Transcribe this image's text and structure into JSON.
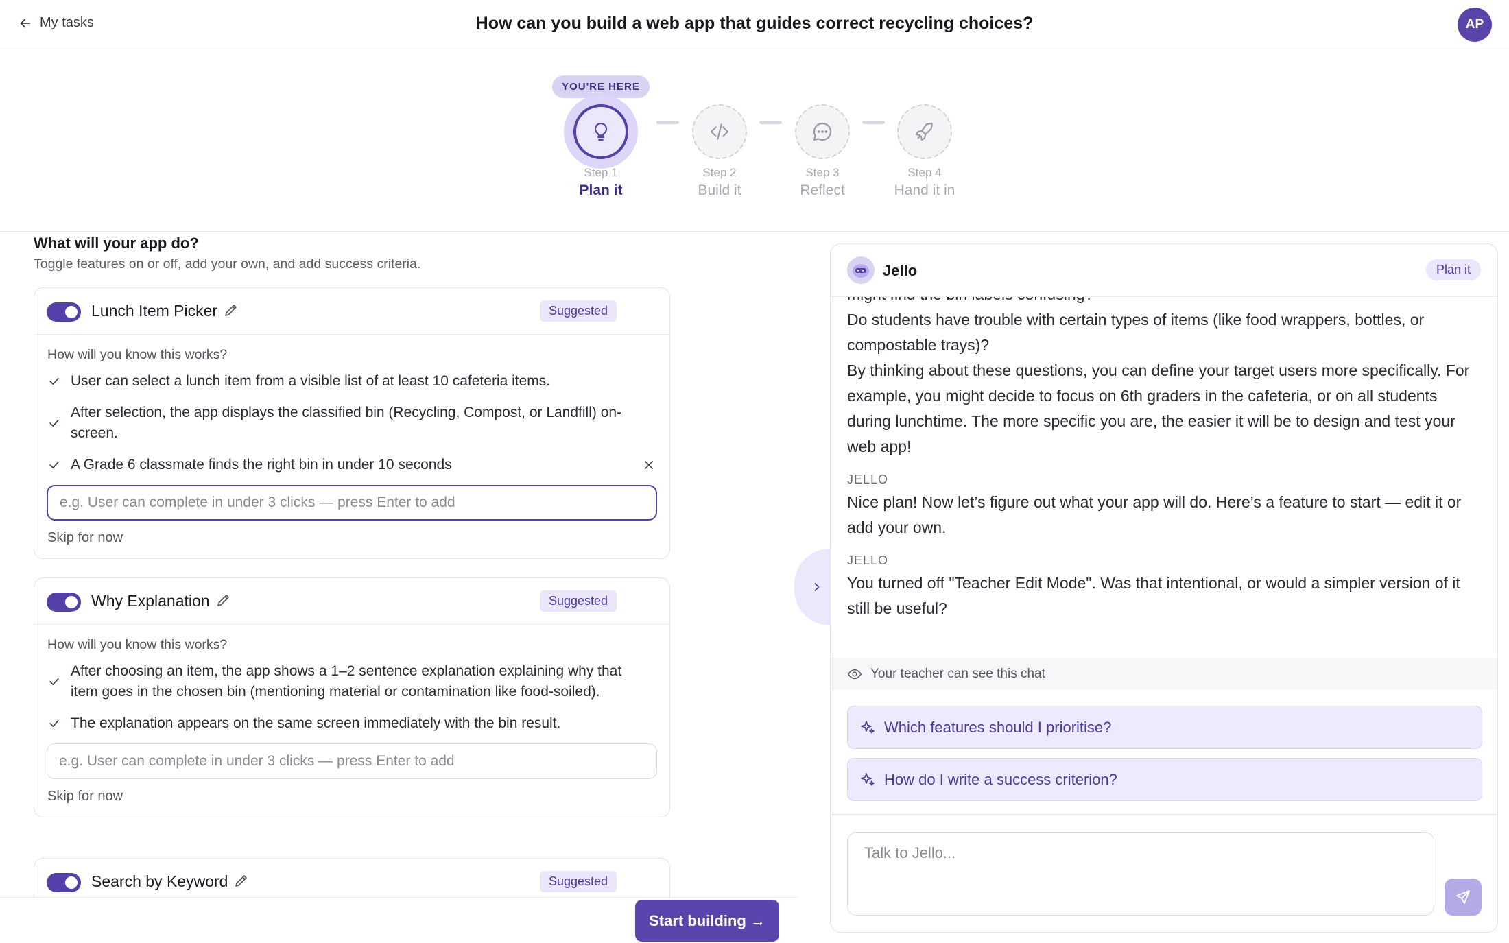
{
  "header": {
    "back_label": "My tasks",
    "title": "How can you build a web app that guides correct recycling choices?",
    "avatar_initials": "AP"
  },
  "stepper": {
    "here_badge": "YOU'RE HERE",
    "steps": [
      {
        "num": "Step 1",
        "label": "Plan it",
        "icon": "lightbulb-icon"
      },
      {
        "num": "Step 2",
        "label": "Build it",
        "icon": "code-icon"
      },
      {
        "num": "Step 3",
        "label": "Reflect",
        "icon": "chat-bubble-icon"
      },
      {
        "num": "Step 4",
        "label": "Hand it in",
        "icon": "rocket-icon"
      }
    ]
  },
  "features": {
    "title": "What will your app do?",
    "subtitle": "Toggle features on or off, add your own, and add success criteria.",
    "how_label": "How will you know this works?",
    "skip_label": "Skip for now",
    "input_placeholder": "e.g. User can complete in under 3 clicks — press Enter to add",
    "items": [
      {
        "name": "Lunch Item Picker",
        "badge": "Suggested",
        "enabled": true,
        "criteria": [
          "User can select a lunch item from a visible list of at least 10 cafeteria items.",
          "After selection, the app displays the classified bin (Recycling, Compost, or Landfill) on-screen.",
          "A Grade 6 classmate finds the right bin in under 10 seconds"
        ]
      },
      {
        "name": "Why Explanation",
        "badge": "Suggested",
        "enabled": true,
        "criteria": [
          "After choosing an item, the app shows a 1–2 sentence explanation explaining why that item goes in the chosen bin (mentioning material or contamination like food-soiled).",
          "The explanation appears on the same screen immediately with the bin result."
        ]
      },
      {
        "name": "Search by Keyword",
        "badge": "Suggested",
        "enabled": true,
        "criteria": []
      }
    ],
    "start_button": "Start building →"
  },
  "chat": {
    "assistant_name": "Jello",
    "phase_pill": "Plan it",
    "messages": {
      "m0_cut": "might find the bin labels confusing?",
      "m0_line2": "Do students have trouble with certain types of items (like food wrappers, bottles, or compostable trays)?",
      "m0_line3": "By thinking about these questions, you can define your target users more specifically. For example, you might decide to focus on 6th graders in the cafeteria, or on all students during lunchtime. The more specific you are, the easier it will be to design and test your web app!",
      "speaker": "JELLO",
      "m1": "Nice plan! Now let’s figure out what your app will do. Here’s a feature to start — edit it or add your own.",
      "m2": "You turned off \"Teacher Edit Mode\". Was that intentional, or would a simpler version of it still be useful?"
    },
    "visibility_note": "Your teacher can see this chat",
    "quick_replies": [
      "Which features should I prioritise?",
      "How do I write a success criterion?"
    ],
    "input_placeholder": "Talk to Jello..."
  },
  "colors": {
    "accent": "#5540a8",
    "accent_light": "#ebe6fb",
    "border": "#e2e2e8"
  }
}
